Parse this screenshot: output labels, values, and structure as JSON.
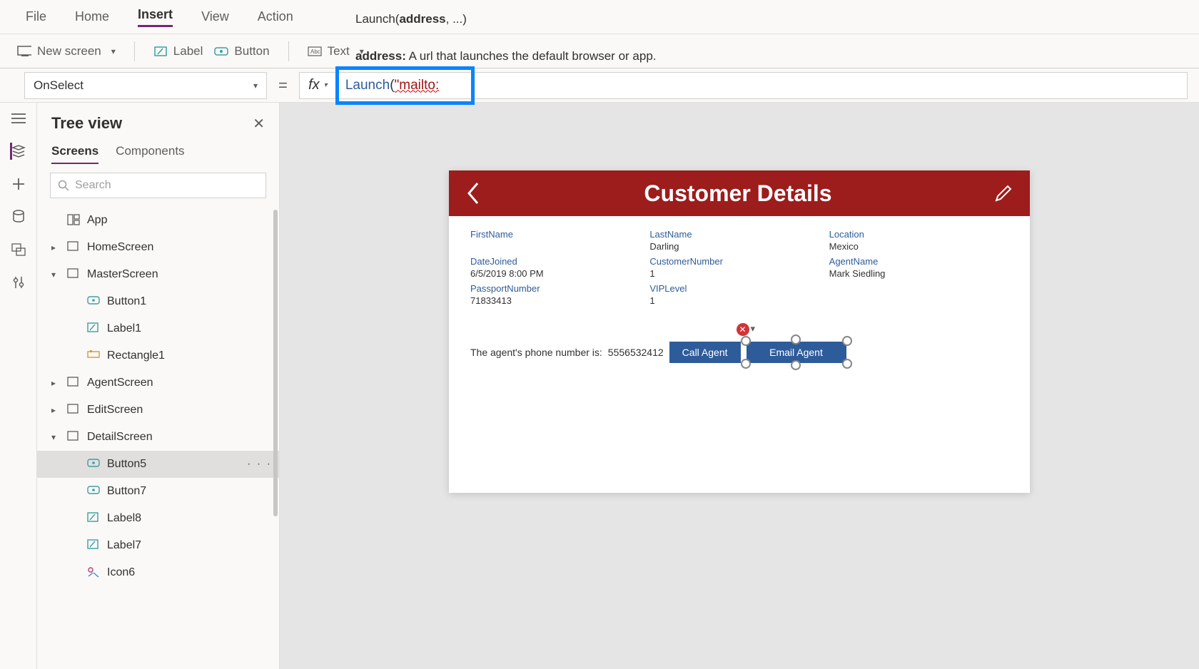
{
  "menu": {
    "file": "File",
    "home": "Home",
    "insert": "Insert",
    "view": "View",
    "action": "Action"
  },
  "ribbon": {
    "newscreen": "New screen",
    "label": "Label",
    "button": "Button",
    "text": "Text"
  },
  "signature": {
    "line1_prefix": "Launch(",
    "line1_bold": "address",
    "line1_suffix": ", ...)",
    "line2_label": "address:",
    "line2_desc": "A url that launches the default browser or app."
  },
  "property": "OnSelect",
  "fx_label": "fx",
  "formula": {
    "fn": "Launch",
    "open": "(",
    "quote": "\"",
    "str": "mailto:"
  },
  "tree": {
    "title": "Tree view",
    "tab_screens": "Screens",
    "tab_components": "Components",
    "search_placeholder": "Search",
    "items": [
      {
        "label": "App",
        "depth": 0,
        "icon": "app",
        "caret": ""
      },
      {
        "label": "HomeScreen",
        "depth": 0,
        "icon": "screen",
        "caret": ">"
      },
      {
        "label": "MasterScreen",
        "depth": 0,
        "icon": "screen",
        "caret": "v"
      },
      {
        "label": "Button1",
        "depth": 2,
        "icon": "button"
      },
      {
        "label": "Label1",
        "depth": 2,
        "icon": "label"
      },
      {
        "label": "Rectangle1",
        "depth": 2,
        "icon": "rect"
      },
      {
        "label": "AgentScreen",
        "depth": 0,
        "icon": "screen",
        "caret": ">"
      },
      {
        "label": "EditScreen",
        "depth": 0,
        "icon": "screen",
        "caret": ">"
      },
      {
        "label": "DetailScreen",
        "depth": 0,
        "icon": "screen",
        "caret": "v"
      },
      {
        "label": "Button5",
        "depth": 2,
        "icon": "button",
        "selected": true,
        "more": "· · ·"
      },
      {
        "label": "Button7",
        "depth": 2,
        "icon": "button"
      },
      {
        "label": "Label8",
        "depth": 2,
        "icon": "label"
      },
      {
        "label": "Label7",
        "depth": 2,
        "icon": "label"
      },
      {
        "label": "Icon6",
        "depth": 2,
        "icon": "icon"
      }
    ]
  },
  "app": {
    "title": "Customer Details",
    "fields": {
      "firstname_label": "FirstName",
      "firstname_val": "",
      "lastname_label": "LastName",
      "lastname_val": "Darling",
      "location_label": "Location",
      "location_val": "Mexico",
      "datejoined_label": "DateJoined",
      "datejoined_val": "6/5/2019 8:00 PM",
      "custnum_label": "CustomerNumber",
      "custnum_val": "1",
      "agentname_label": "AgentName",
      "agentname_val": "Mark Siedling",
      "passport_label": "PassportNumber",
      "passport_val": "71833413",
      "vip_label": "VIPLevel",
      "vip_val": "1"
    },
    "agent_text": "The agent's phone number is:",
    "agent_phone": "5556532412",
    "btn_call": "Call Agent",
    "btn_email": "Email Agent",
    "error_badge": "✕"
  }
}
